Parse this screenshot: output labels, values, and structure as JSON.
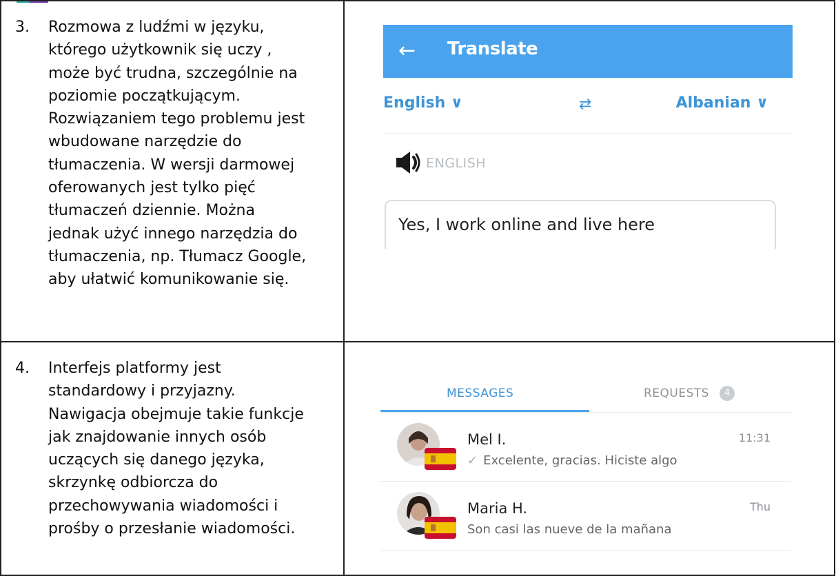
{
  "items": [
    {
      "number": "3.",
      "text": "Rozmowa z ludźmi w języku,\nktórego użytkownik się uczy ,\nmoże być trudna, szczególnie na\npoziomie początkującym.\nRozwiązaniem tego problemu jest\nwbudowane narzędzie do\ntłumaczenia. W wersji darmowej\noferowanych jest tylko pięć\ntłumaczeń dziennie. Można\njednak użyć innego narzędzia do\ntłumaczenia, np. Tłumacz Google,\naby ułatwić komunikowanie się."
    },
    {
      "number": "4.",
      "text": "Interfejs platformy jest\nstandardowy i przyjazny.\nNawigacja obejmuje takie funkcje\njak znajdowanie innych osób\nuczących się danego języka,\nskrzynkę odbiorcza do\nprzechowywania wiadomości i\nprośby o przesłanie wiadomości."
    }
  ],
  "translate": {
    "back_glyph": "←",
    "title": "Translate",
    "source_language": "English ∨",
    "target_language": "Albanian ∨",
    "swap_glyph": "⇄",
    "source_label": "ENGLISH",
    "input_text": "Yes, I work online and live here",
    "colors": {
      "header": "#4aa3ec",
      "accent": "#3f94d6"
    }
  },
  "messages": {
    "tabs": [
      {
        "label": "MESSAGES",
        "active": true
      },
      {
        "label": "REQUESTS",
        "badge": "4"
      }
    ],
    "conversations": [
      {
        "name": "Mel I.",
        "time": "11:31",
        "preview": "Excelente, gracias. Hiciste algo",
        "read_check": "✓"
      },
      {
        "name": "Maria H.",
        "time": "Thu",
        "preview": "Son casi las nueve de la mañana"
      }
    ]
  }
}
